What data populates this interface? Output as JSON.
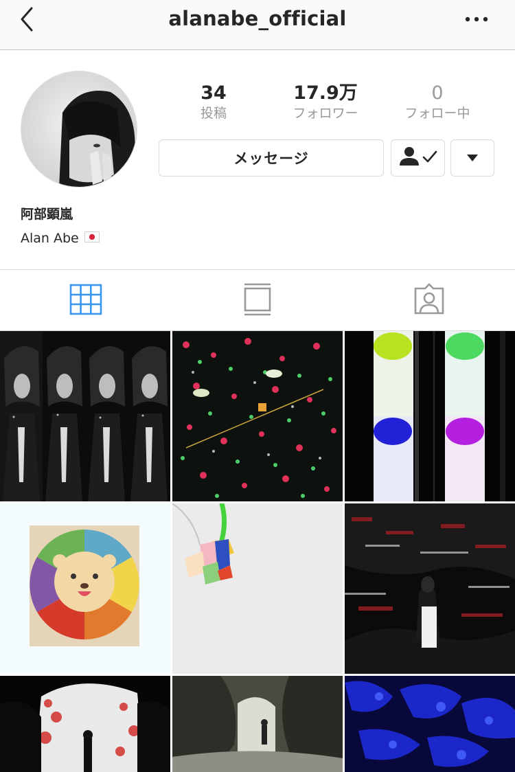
{
  "header": {
    "username": "alanabe_official",
    "back_icon": "chevron-left-icon",
    "more_icon": "ellipsis-icon"
  },
  "profile": {
    "avatar_icon": "avatar",
    "stats": {
      "posts": {
        "count": "34",
        "label": "投稿"
      },
      "followers": {
        "count": "17.9万",
        "label": "フォロワー"
      },
      "following": {
        "count": "0",
        "label": "フォロー中"
      }
    },
    "buttons": {
      "message_label": "メッセージ",
      "following_icon": "person-check-icon",
      "dropdown_icon": "triangle-down-icon"
    },
    "display_name": "阿部顕嵐",
    "bio": "Alan Abe",
    "bio_flag_icon": "japan-flag-icon"
  },
  "tabs": [
    {
      "icon": "grid-icon",
      "active": true
    },
    {
      "icon": "feed-icon",
      "active": false
    },
    {
      "icon": "tagged-person-icon",
      "active": false
    }
  ],
  "colors": {
    "active_tab": "#3897f0",
    "inactive_tab": "#999999",
    "text": "#262626",
    "secondary_text": "#999999",
    "border": "#dbdbdb"
  },
  "posts": [
    {
      "id": "post-1",
      "desc_icon": "photo-thumbnail"
    },
    {
      "id": "post-2",
      "desc_icon": "photo-thumbnail"
    },
    {
      "id": "post-3",
      "desc_icon": "photo-thumbnail"
    },
    {
      "id": "post-4",
      "desc_icon": "photo-thumbnail"
    },
    {
      "id": "post-5",
      "desc_icon": "photo-thumbnail"
    },
    {
      "id": "post-6",
      "desc_icon": "photo-thumbnail"
    },
    {
      "id": "post-7",
      "desc_icon": "photo-thumbnail"
    },
    {
      "id": "post-8",
      "desc_icon": "photo-thumbnail"
    },
    {
      "id": "post-9",
      "desc_icon": "photo-thumbnail"
    }
  ]
}
